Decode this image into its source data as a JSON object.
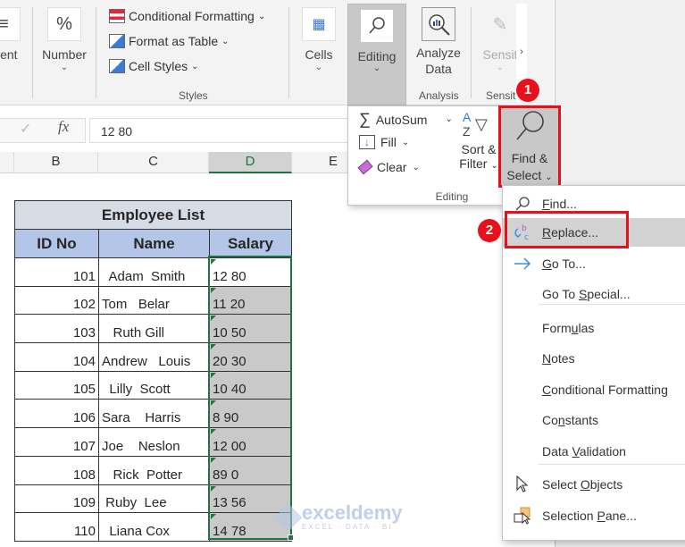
{
  "ribbon": {
    "alignment_label_partial": "ment",
    "number": {
      "label": "Number",
      "icon": "%"
    },
    "styles": {
      "items": [
        {
          "label": "Conditional Formatting"
        },
        {
          "label": "Format as Table"
        },
        {
          "label": "Cell Styles"
        }
      ],
      "group_label": "Styles"
    },
    "cells": {
      "label": "Cells"
    },
    "editing": {
      "label": "Editing"
    },
    "analyze": {
      "label_line1": "Analyze",
      "label_line2": "Data",
      "group_label": "Analysis"
    },
    "sensitivity": {
      "label": "Sensit",
      "group_label": "Sensit"
    }
  },
  "formula_bar": {
    "fx": "fx",
    "value": "12 80"
  },
  "columns": [
    {
      "label": "B"
    },
    {
      "label": "C"
    },
    {
      "label": "D",
      "active": true
    },
    {
      "label": "E"
    }
  ],
  "sheet": {
    "title": "Employee List",
    "headers": [
      "ID No",
      "Name",
      "Salary"
    ],
    "rows": [
      {
        "id": "101",
        "name": "  Adam  Smith",
        "salary": "12 80"
      },
      {
        "id": "102",
        "name": "Tom   Belar",
        "salary": "11 20"
      },
      {
        "id": "103",
        "name": "   Ruth Gill",
        "salary": "10 50"
      },
      {
        "id": "104",
        "name": "Andrew   Louis",
        "salary": "20 30"
      },
      {
        "id": "105",
        "name": "  Lilly  Scott",
        "salary": "10 40"
      },
      {
        "id": "106",
        "name": "Sara    Harris",
        "salary": "8 90"
      },
      {
        "id": "107",
        "name": "Joe    Neslon",
        "salary": "12 00"
      },
      {
        "id": "108",
        "name": "   Rick  Potter",
        "salary": "89 0"
      },
      {
        "id": "109",
        "name": " Ruby  Lee",
        "salary": "13 56"
      },
      {
        "id": "110",
        "name": "  Liana Cox",
        "salary": "14 78"
      }
    ]
  },
  "editing_panel": {
    "autosum": "AutoSum",
    "fill": "Fill",
    "clear": "Clear",
    "sort_line1": "Sort &",
    "sort_line2": "Filter",
    "find_line1": "Find &",
    "find_line2": "Select",
    "group_label": "Editing"
  },
  "menu": {
    "items": [
      {
        "pre": "",
        "ul": "F",
        "post": "ind...",
        "icon": "search-icon"
      },
      {
        "pre": "",
        "ul": "R",
        "post": "eplace...",
        "icon": "replace-icon",
        "highlighted": true
      },
      {
        "pre": "",
        "ul": "G",
        "post": "o To...",
        "icon": "arrow-right-icon"
      },
      {
        "pre": "Go To ",
        "ul": "S",
        "post": "pecial...",
        "icon": ""
      },
      {
        "pre": "Form",
        "ul": "u",
        "post": "las",
        "icon": ""
      },
      {
        "pre": "",
        "ul": "N",
        "post": "otes",
        "icon": ""
      },
      {
        "pre": "",
        "ul": "C",
        "post": "onditional Formatting",
        "icon": ""
      },
      {
        "pre": "Co",
        "ul": "n",
        "post": "stants",
        "icon": ""
      },
      {
        "pre": "Data ",
        "ul": "V",
        "post": "alidation",
        "icon": ""
      },
      {
        "pre": "Select ",
        "ul": "O",
        "post": "bjects",
        "icon": "cursor-icon"
      },
      {
        "pre": "Selection ",
        "ul": "P",
        "post": "ane...",
        "icon": "selection-pane-icon"
      }
    ]
  },
  "badges": {
    "step1": "1",
    "step2": "2"
  },
  "watermark": {
    "name": "exceldemy",
    "sub": "EXCEL · DATA · BI"
  },
  "colors": {
    "accent_green": "#217346",
    "highlight_red": "#e8111b",
    "title_fill": "#d6dce4",
    "header_fill": "#b4c6e7"
  }
}
